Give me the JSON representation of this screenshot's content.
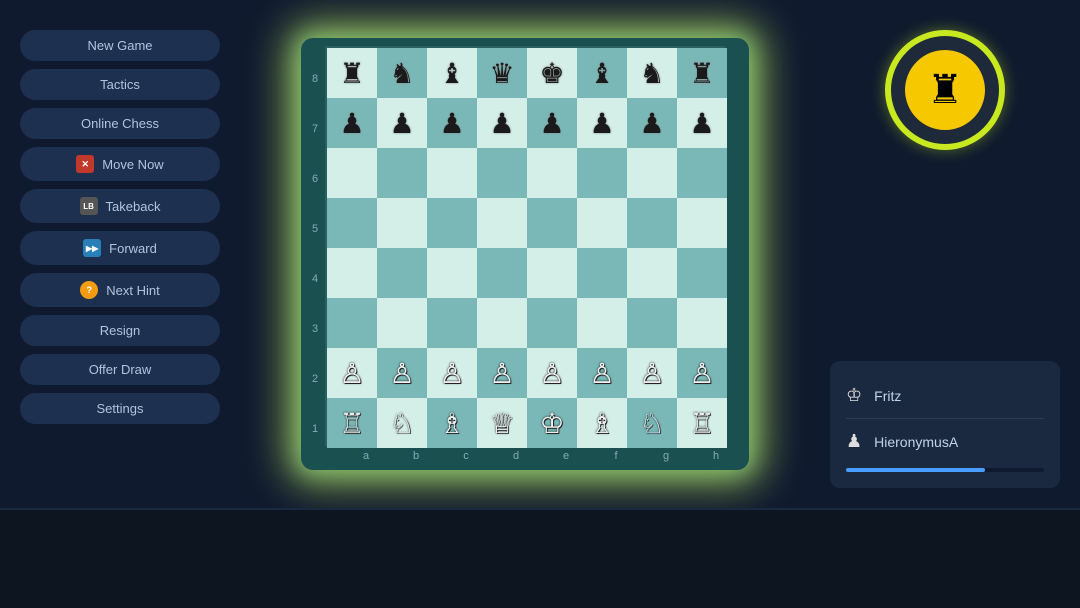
{
  "sidebar": {
    "buttons": [
      {
        "id": "new-game",
        "label": "New Game",
        "icon": null
      },
      {
        "id": "tactics",
        "label": "Tactics",
        "icon": null
      },
      {
        "id": "online-chess",
        "label": "Online Chess",
        "icon": null
      },
      {
        "id": "move-now",
        "label": "Move Now",
        "icon": "X",
        "icon_class": "red"
      },
      {
        "id": "takeback",
        "label": "Takeback",
        "icon": "LB",
        "icon_class": "dark"
      },
      {
        "id": "forward",
        "label": "Forward",
        "icon": "▶▶",
        "icon_class": "blue"
      },
      {
        "id": "next-hint",
        "label": "Next Hint",
        "icon": "?",
        "icon_class": "yellow"
      },
      {
        "id": "resign",
        "label": "Resign",
        "icon": null
      },
      {
        "id": "offer-draw",
        "label": "Offer Draw",
        "icon": null
      },
      {
        "id": "settings",
        "label": "Settings",
        "icon": null
      }
    ]
  },
  "board": {
    "ranks": [
      "8",
      "7",
      "6",
      "5",
      "4",
      "3",
      "2",
      "1"
    ],
    "files": [
      "a",
      "b",
      "c",
      "d",
      "e",
      "f",
      "g",
      "h"
    ]
  },
  "players": {
    "opponent": {
      "name": "Fritz",
      "icon": "♔"
    },
    "player": {
      "name": "HieronymusA",
      "icon": "♟"
    },
    "progress": 70
  },
  "logo": {
    "icon": "♜"
  }
}
